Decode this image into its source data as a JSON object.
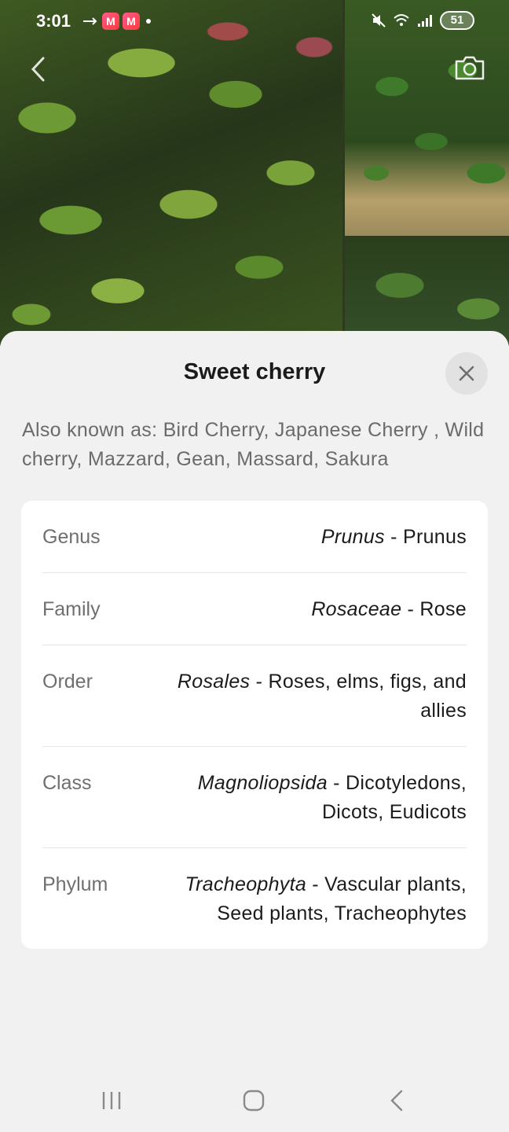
{
  "status_bar": {
    "time": "3:01",
    "app_badge_1": "M",
    "app_badge_2": "M",
    "battery": "51"
  },
  "plant": {
    "common_name": "Sweet cherry",
    "also_known_as": "Also known as: Bird Cherry, Japanese Cherry , Wild cherry, Mazzard, Gean, Massard, Sakura"
  },
  "taxonomy": [
    {
      "label": "Genus",
      "scientific": "Prunus",
      "common": " - Prunus"
    },
    {
      "label": "Family",
      "scientific": "Rosaceae",
      "common": " - Rose"
    },
    {
      "label": "Order",
      "scientific": "Rosales",
      "common": " - Roses, elms, figs, and allies"
    },
    {
      "label": "Class",
      "scientific": "Magnoliopsida",
      "common": " - Dicotyledons, Dicots, Eudicots"
    },
    {
      "label": "Phylum",
      "scientific": "Tracheophyta",
      "common": " - Vascular plants, Seed plants, Tracheophytes"
    }
  ],
  "icons": {
    "back": "chevron-left-icon",
    "camera": "camera-icon",
    "close": "close-icon",
    "nav_recents": "recents-icon",
    "nav_home": "home-icon",
    "nav_back": "back-icon"
  },
  "colors": {
    "sheet_background": "#f1f1f1",
    "card_background": "#ffffff",
    "secondary_text": "#6f6f6f"
  }
}
